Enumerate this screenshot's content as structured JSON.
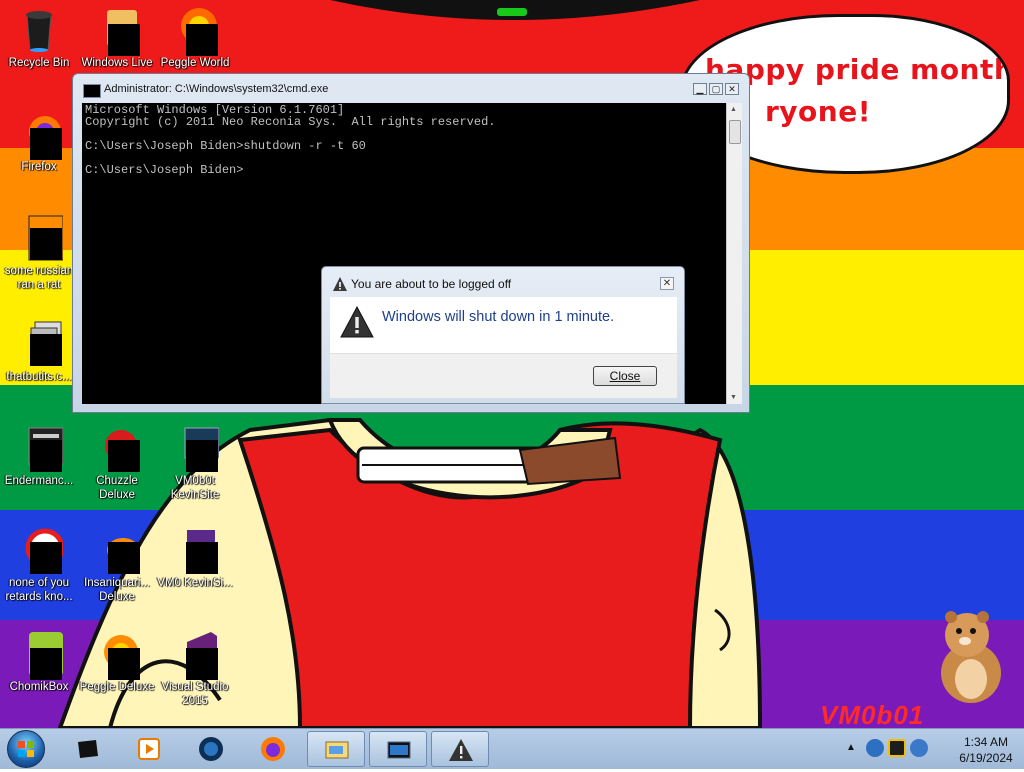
{
  "wallpaper": {
    "speech": [
      "happy pride month",
      "ryone!"
    ],
    "watermark": "VM0b01"
  },
  "desktop_icons": [
    {
      "label": "Recycle Bin"
    },
    {
      "label": "Windows Live"
    },
    {
      "label": "Peggle World"
    },
    {
      "label": "Firefox"
    },
    {
      "label": "some russian ran a rat"
    },
    {
      "label": "thatbutits.c..."
    },
    {
      "label": "Endermanc..."
    },
    {
      "label": "Chuzzle Deluxe"
    },
    {
      "label": "VM0b0t KevinSite"
    },
    {
      "label": "none of you retards kno..."
    },
    {
      "label": "Insaniquari... Deluxe"
    },
    {
      "label": "VM0 KevinSi..."
    },
    {
      "label": "ChomikBox"
    },
    {
      "label": "Peggle Deluxe"
    },
    {
      "label": "Visual Studio 2015"
    }
  ],
  "cmd_window": {
    "title": "Administrator: C:\\Windows\\system32\\cmd.exe",
    "lines": [
      "Microsoft Windows [Version 6.1.7601]",
      "Copyright (c) 2011 Neo Reconia Sys.  All rights reserved.",
      "",
      "C:\\Users\\Joseph Biden>shutdown -r -t 60",
      "",
      "C:\\Users\\Joseph Biden>"
    ]
  },
  "dialog": {
    "title": "You are about to be logged off",
    "message": "Windows will shut down in 1 minute.",
    "close_label": "Close"
  },
  "taskbar": {
    "pinned": [
      "terminal-icon",
      "media-player-icon",
      "globe-app-icon",
      "firefox-icon",
      "explorer-window-icon",
      "cmd-window-icon",
      "warning-window-icon"
    ],
    "clock_time": "1:34 AM",
    "clock_date": "6/19/2024"
  },
  "colors": {
    "red": "#ef1a1a",
    "orange": "#ff8c00",
    "yellow": "#ffee00",
    "green": "#009944",
    "blue": "#1f3fe0",
    "purple": "#7a1ab8",
    "dialog_text": "#1e3f8a"
  }
}
